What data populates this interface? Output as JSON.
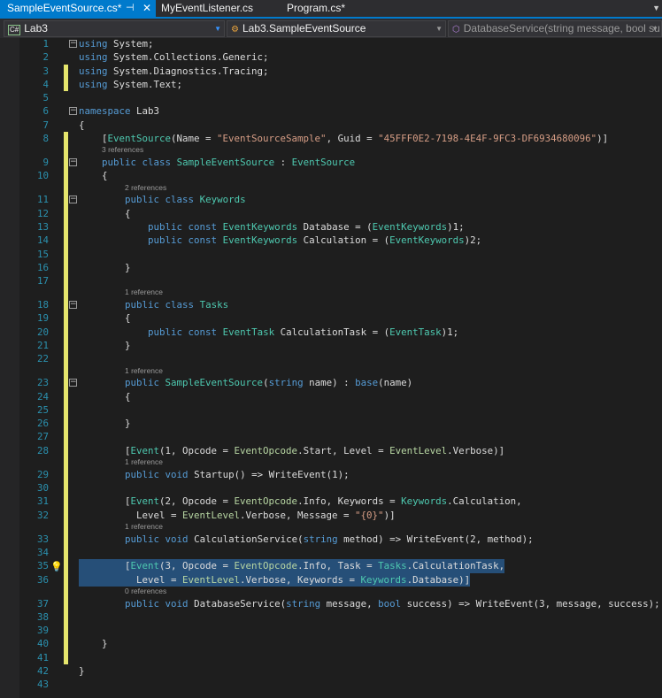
{
  "tabs": [
    {
      "label": "SampleEventSource.cs*",
      "active": true
    },
    {
      "label": "MyEventListener.cs"
    },
    {
      "label": "Program.cs*"
    }
  ],
  "nav": {
    "project": "Lab3",
    "project_icon": "C#",
    "type": "Lab3.SampleEventSource",
    "member": "DatabaseService(string message, bool su"
  },
  "colors": {
    "accent": "#007acc",
    "keyword": "#569cd6",
    "type": "#4ec9b0",
    "string": "#d69d85",
    "selection": "#264f78"
  },
  "lines": [
    {
      "n": "1",
      "fold": true,
      "tokens": [
        [
          "k",
          "using"
        ],
        [
          "p",
          " System;"
        ]
      ]
    },
    {
      "n": "2",
      "tokens": [
        [
          "k",
          "using"
        ],
        [
          "p",
          " System.Collections.Generic;"
        ]
      ]
    },
    {
      "n": "3",
      "chg": true,
      "tokens": [
        [
          "k",
          "using"
        ],
        [
          "p",
          " System.Diagnostics.Tracing;"
        ]
      ]
    },
    {
      "n": "4",
      "chg": true,
      "tokens": [
        [
          "k",
          "using"
        ],
        [
          "p",
          " System.Text;"
        ]
      ]
    },
    {
      "n": "5",
      "tokens": []
    },
    {
      "n": "6",
      "fold": true,
      "tokens": [
        [
          "k",
          "namespace"
        ],
        [
          "p",
          " Lab3"
        ]
      ]
    },
    {
      "n": "7",
      "tokens": [
        [
          "p",
          "{"
        ]
      ]
    },
    {
      "n": "8",
      "chg": true,
      "tokens": [
        [
          "p",
          "    ["
        ],
        [
          "t",
          "EventSource"
        ],
        [
          "p",
          "(Name = "
        ],
        [
          "s",
          "\"EventSourceSample\""
        ],
        [
          "p",
          ", Guid = "
        ],
        [
          "s",
          "\"45FFF0E2-7198-4E4F-9FC3-DF6934680096\""
        ],
        [
          "p",
          ")]"
        ]
      ]
    },
    {
      "n": "9",
      "chg": true,
      "fold": true,
      "refs": "3 references",
      "rind": 4,
      "tokens": [
        [
          "p",
          "    "
        ],
        [
          "k",
          "public"
        ],
        [
          "p",
          " "
        ],
        [
          "k",
          "class"
        ],
        [
          "p",
          " "
        ],
        [
          "t",
          "SampleEventSource"
        ],
        [
          "p",
          " : "
        ],
        [
          "t",
          "EventSource"
        ]
      ]
    },
    {
      "n": "10",
      "chg": true,
      "tokens": [
        [
          "p",
          "    {"
        ]
      ]
    },
    {
      "n": "11",
      "chg": true,
      "fold": true,
      "refs": "2 references",
      "rind": 8,
      "tokens": [
        [
          "p",
          "        "
        ],
        [
          "k",
          "public"
        ],
        [
          "p",
          " "
        ],
        [
          "k",
          "class"
        ],
        [
          "p",
          " "
        ],
        [
          "t",
          "Keywords"
        ]
      ]
    },
    {
      "n": "12",
      "chg": true,
      "tokens": [
        [
          "p",
          "        {"
        ]
      ]
    },
    {
      "n": "13",
      "chg": true,
      "tokens": [
        [
          "p",
          "            "
        ],
        [
          "k",
          "public"
        ],
        [
          "p",
          " "
        ],
        [
          "k",
          "const"
        ],
        [
          "p",
          " "
        ],
        [
          "t",
          "EventKeywords"
        ],
        [
          "p",
          " Database = ("
        ],
        [
          "t",
          "EventKeywords"
        ],
        [
          "p",
          ")1;"
        ]
      ]
    },
    {
      "n": "14",
      "chg": true,
      "tokens": [
        [
          "p",
          "            "
        ],
        [
          "k",
          "public"
        ],
        [
          "p",
          " "
        ],
        [
          "k",
          "const"
        ],
        [
          "p",
          " "
        ],
        [
          "t",
          "EventKeywords"
        ],
        [
          "p",
          " Calculation = ("
        ],
        [
          "t",
          "EventKeywords"
        ],
        [
          "p",
          ")2;"
        ]
      ]
    },
    {
      "n": "15",
      "chg": true,
      "tokens": []
    },
    {
      "n": "16",
      "chg": true,
      "tokens": [
        [
          "p",
          "        }"
        ]
      ]
    },
    {
      "n": "17",
      "chg": true,
      "tokens": []
    },
    {
      "n": "18",
      "chg": true,
      "fold": true,
      "refs": "1 reference",
      "rind": 8,
      "tokens": [
        [
          "p",
          "        "
        ],
        [
          "k",
          "public"
        ],
        [
          "p",
          " "
        ],
        [
          "k",
          "class"
        ],
        [
          "p",
          " "
        ],
        [
          "t",
          "Tasks"
        ]
      ]
    },
    {
      "n": "19",
      "chg": true,
      "tokens": [
        [
          "p",
          "        {"
        ]
      ]
    },
    {
      "n": "20",
      "chg": true,
      "tokens": [
        [
          "p",
          "            "
        ],
        [
          "k",
          "public"
        ],
        [
          "p",
          " "
        ],
        [
          "k",
          "const"
        ],
        [
          "p",
          " "
        ],
        [
          "t",
          "EventTask"
        ],
        [
          "p",
          " CalculationTask = ("
        ],
        [
          "t",
          "EventTask"
        ],
        [
          "p",
          ")1;"
        ]
      ]
    },
    {
      "n": "21",
      "chg": true,
      "tokens": [
        [
          "p",
          "        }"
        ]
      ]
    },
    {
      "n": "22",
      "chg": true,
      "tokens": []
    },
    {
      "n": "23",
      "chg": true,
      "fold": true,
      "refs": "1 reference",
      "rind": 8,
      "tokens": [
        [
          "p",
          "        "
        ],
        [
          "k",
          "public"
        ],
        [
          "p",
          " "
        ],
        [
          "t",
          "SampleEventSource"
        ],
        [
          "p",
          "("
        ],
        [
          "k",
          "string"
        ],
        [
          "p",
          " name) : "
        ],
        [
          "k",
          "base"
        ],
        [
          "p",
          "(name)"
        ]
      ]
    },
    {
      "n": "24",
      "chg": true,
      "tokens": [
        [
          "p",
          "        {"
        ]
      ]
    },
    {
      "n": "25",
      "chg": true,
      "tokens": []
    },
    {
      "n": "26",
      "chg": true,
      "tokens": [
        [
          "p",
          "        }"
        ]
      ]
    },
    {
      "n": "27",
      "chg": true,
      "tokens": []
    },
    {
      "n": "28",
      "chg": true,
      "tokens": [
        [
          "p",
          "        ["
        ],
        [
          "t",
          "Event"
        ],
        [
          "p",
          "(1, Opcode = "
        ],
        [
          "e",
          "EventOpcode"
        ],
        [
          "p",
          ".Start, Level = "
        ],
        [
          "e",
          "EventLevel"
        ],
        [
          "p",
          ".Verbose)]"
        ]
      ]
    },
    {
      "n": "29",
      "chg": true,
      "refs": "1 reference",
      "rind": 8,
      "tokens": [
        [
          "p",
          "        "
        ],
        [
          "k",
          "public"
        ],
        [
          "p",
          " "
        ],
        [
          "k",
          "void"
        ],
        [
          "p",
          " Startup() => "
        ],
        [
          "m",
          "WriteEvent"
        ],
        [
          "p",
          "(1);"
        ]
      ]
    },
    {
      "n": "30",
      "chg": true,
      "tokens": []
    },
    {
      "n": "31",
      "chg": true,
      "tokens": [
        [
          "p",
          "        ["
        ],
        [
          "t",
          "Event"
        ],
        [
          "p",
          "(2, Opcode = "
        ],
        [
          "e",
          "EventOpcode"
        ],
        [
          "p",
          ".Info, Keywords = "
        ],
        [
          "t",
          "Keywords"
        ],
        [
          "p",
          ".Calculation,"
        ]
      ]
    },
    {
      "n": "32",
      "chg": true,
      "tokens": [
        [
          "p",
          "          Level = "
        ],
        [
          "e",
          "EventLevel"
        ],
        [
          "p",
          ".Verbose, Message = "
        ],
        [
          "s",
          "\"{0}\""
        ],
        [
          "p",
          ")]"
        ]
      ]
    },
    {
      "n": "33",
      "chg": true,
      "refs": "1 reference",
      "rind": 8,
      "tokens": [
        [
          "p",
          "        "
        ],
        [
          "k",
          "public"
        ],
        [
          "p",
          " "
        ],
        [
          "k",
          "void"
        ],
        [
          "p",
          " CalculationService("
        ],
        [
          "k",
          "string"
        ],
        [
          "p",
          " method) => "
        ],
        [
          "m",
          "WriteEvent"
        ],
        [
          "p",
          "(2, method);"
        ]
      ]
    },
    {
      "n": "34",
      "chg": true,
      "tokens": []
    },
    {
      "n": "35",
      "chg": true,
      "bulb": true,
      "sel": true,
      "tokens": [
        [
          "p",
          "        ["
        ],
        [
          "t",
          "Event"
        ],
        [
          "p",
          "(3, Opcode = "
        ],
        [
          "e",
          "EventOpcode"
        ],
        [
          "p",
          ".Info, Task = "
        ],
        [
          "t",
          "Tasks"
        ],
        [
          "p",
          ".CalculationTask,"
        ]
      ]
    },
    {
      "n": "36",
      "chg": true,
      "sel": true,
      "tokens": [
        [
          "p",
          "          Level = "
        ],
        [
          "e",
          "EventLevel"
        ],
        [
          "p",
          ".Verbose, Keywords = "
        ],
        [
          "t",
          "Keywords"
        ],
        [
          "p",
          ".Database)]"
        ]
      ]
    },
    {
      "n": "37",
      "chg": true,
      "refs": "0 references",
      "rind": 8,
      "tokens": [
        [
          "p",
          "        "
        ],
        [
          "k",
          "public"
        ],
        [
          "p",
          " "
        ],
        [
          "k",
          "void"
        ],
        [
          "p",
          " DatabaseService("
        ],
        [
          "k",
          "string"
        ],
        [
          "p",
          " message, "
        ],
        [
          "k",
          "bool"
        ],
        [
          "p",
          " success) => "
        ],
        [
          "m",
          "WriteEvent"
        ],
        [
          "p",
          "(3, message, success);"
        ]
      ]
    },
    {
      "n": "38",
      "chg": true,
      "tokens": []
    },
    {
      "n": "39",
      "chg": true,
      "tokens": []
    },
    {
      "n": "40",
      "chg": true,
      "tokens": [
        [
          "p",
          "    }"
        ]
      ]
    },
    {
      "n": "41",
      "chg": true,
      "tokens": []
    },
    {
      "n": "42",
      "tokens": [
        [
          "p",
          "}"
        ]
      ]
    },
    {
      "n": "43",
      "tokens": []
    }
  ]
}
